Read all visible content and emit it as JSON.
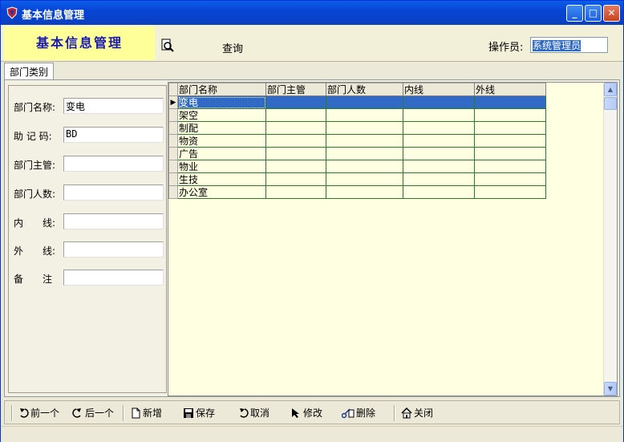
{
  "window": {
    "title": "基本信息管理",
    "minimize": "_",
    "maximize": "□",
    "close": "✕"
  },
  "header": {
    "banner": "基本信息管理",
    "query_label": "查询",
    "operator_label": "操作员:",
    "operator_value": "系统管理员"
  },
  "tab": {
    "label": "部门类别"
  },
  "form": {
    "dept_name_label": "部门名称:",
    "dept_name_value": "变电",
    "mnemonic_label": "助 记 码:",
    "mnemonic_value": "BD",
    "supervisor_label": "部门主管:",
    "supervisor_value": "",
    "headcount_label": "部门人数:",
    "headcount_value": "",
    "internal_label": "内　　线:",
    "internal_value": "",
    "external_label": "外　　线:",
    "external_value": "",
    "remark_label": "备　　注",
    "remark_value": ""
  },
  "grid": {
    "columns": [
      "部门名称",
      "部门主管",
      "部门人数",
      "内线",
      "外线"
    ],
    "rows": [
      [
        "变电",
        "",
        "",
        "",
        ""
      ],
      [
        "架空",
        "",
        "",
        "",
        ""
      ],
      [
        "制配",
        "",
        "",
        "",
        ""
      ],
      [
        "物资",
        "",
        "",
        "",
        ""
      ],
      [
        "广告",
        "",
        "",
        "",
        ""
      ],
      [
        "物业",
        "",
        "",
        "",
        ""
      ],
      [
        "生技",
        "",
        "",
        "",
        ""
      ],
      [
        "办公室",
        "",
        "",
        "",
        ""
      ]
    ],
    "selected_row": 0
  },
  "toolbar": {
    "prev": "前一个",
    "next": "后一个",
    "new": "新增",
    "save": "保存",
    "cancel": "取消",
    "edit": "修改",
    "delete": "删除",
    "close": "关闭"
  },
  "colors": {
    "title_bar": "#0845d6",
    "banner_bg": "#ffff99",
    "banner_text": "#1a1ab0",
    "selection": "#316ac5",
    "grid_bg": "#ffffe1",
    "grid_lines": "#2c7a2c"
  }
}
